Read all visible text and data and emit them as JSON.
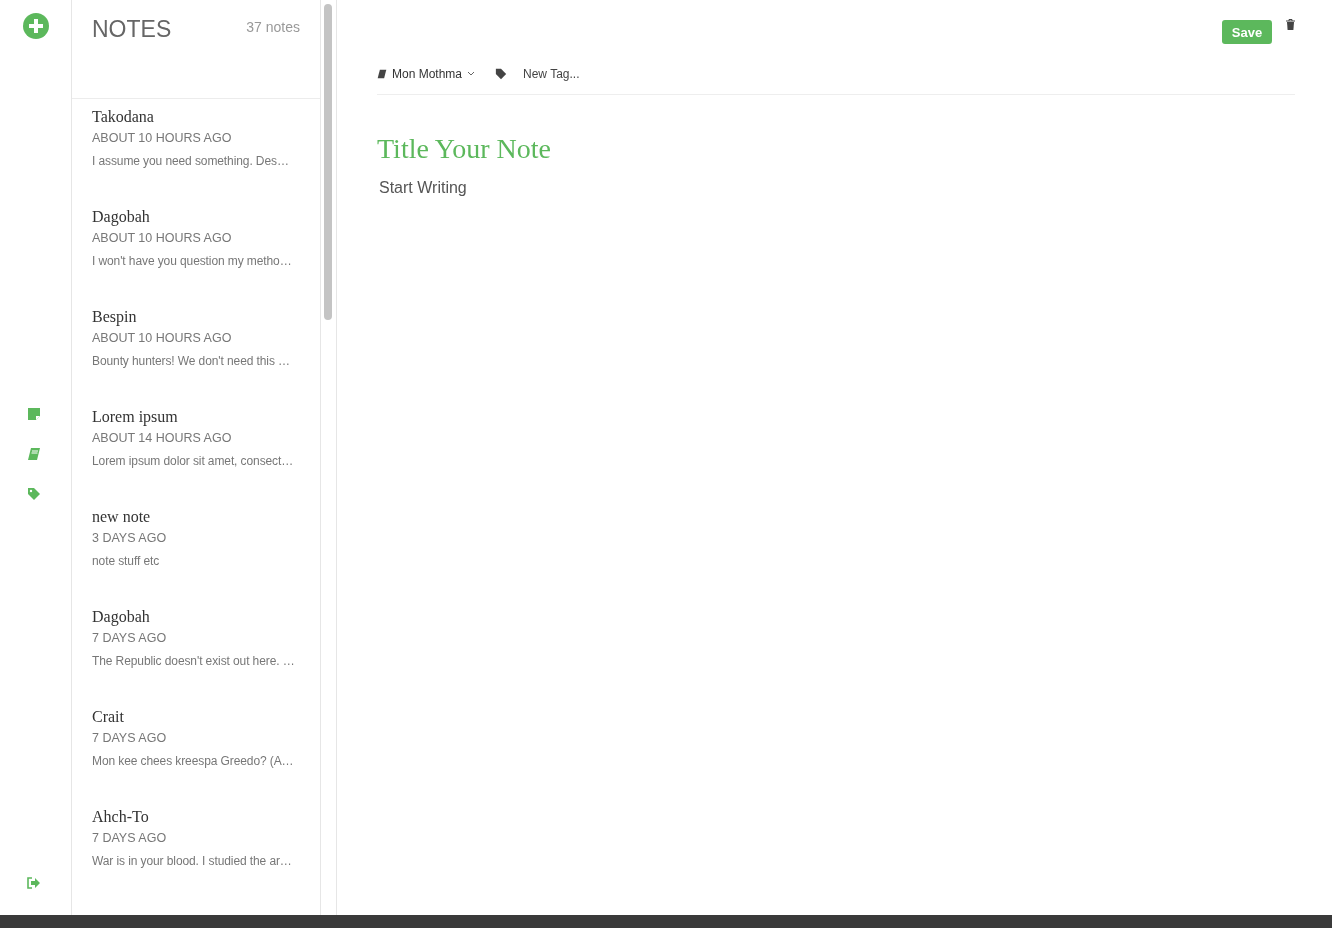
{
  "rail": {
    "items": [
      {
        "kind": "notes",
        "selected": false
      },
      {
        "kind": "notebooks",
        "selected": false
      },
      {
        "kind": "tags",
        "selected": false
      }
    ]
  },
  "list": {
    "title": "NOTES",
    "count": "37 notes",
    "notes": [
      {
        "title": "Takodana",
        "time": "ABOUT 10 HOURS AGO",
        "preview": "I assume you need something. Des…"
      },
      {
        "title": "Dagobah",
        "time": "ABOUT 10 HOURS AGO",
        "preview": "I won't have you question my metho…"
      },
      {
        "title": "Bespin",
        "time": "ABOUT 10 HOURS AGO",
        "preview": "Bounty hunters! We don't need this …"
      },
      {
        "title": "Lorem ipsum",
        "time": "ABOUT 14 HOURS AGO",
        "preview": "Lorem ipsum dolor sit amet, consect…"
      },
      {
        "title": "new note",
        "time": "3 DAYS AGO",
        "preview": "note stuff etc"
      },
      {
        "title": "Dagobah",
        "time": "7 DAYS AGO",
        "preview": "The Republic doesn't exist out here. …"
      },
      {
        "title": "Crait",
        "time": "7 DAYS AGO",
        "preview": "Mon kee chees kreespa Greedo? (A…"
      },
      {
        "title": "Ahch-To",
        "time": "7 DAYS AGO",
        "preview": "War is in your blood. I studied the ar…"
      }
    ]
  },
  "editor": {
    "save": "Save",
    "notebook": "Mon Mothma",
    "tag_placeholder": "New Tag...",
    "title_placeholder": "Title Your Note",
    "body_placeholder": "Start Writing"
  }
}
